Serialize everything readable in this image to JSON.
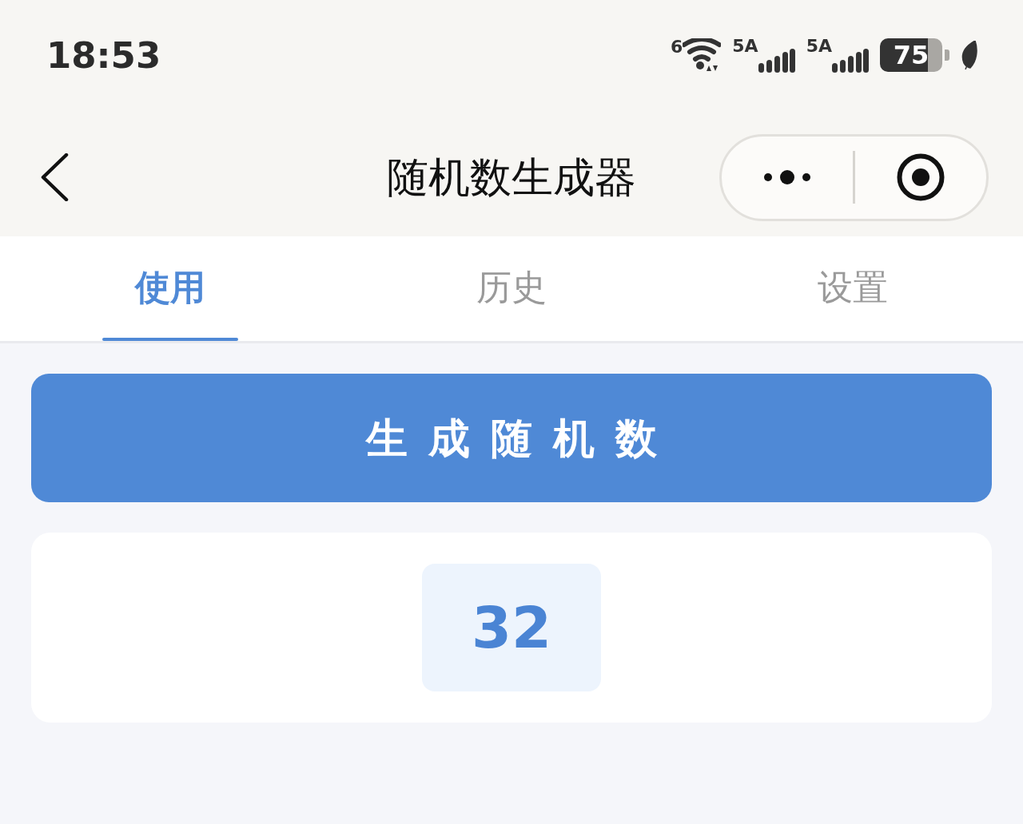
{
  "status_bar": {
    "time": "18:53",
    "wifi_label": "6",
    "signals": [
      "5A",
      "5A"
    ],
    "battery": "75"
  },
  "header": {
    "title": "随机数生成器"
  },
  "tabs": [
    {
      "label": "使用",
      "selected": true
    },
    {
      "label": "历史",
      "selected": false
    },
    {
      "label": "设置",
      "selected": false
    }
  ],
  "generate_button": {
    "label": "生成随机数"
  },
  "result": {
    "value": "32"
  }
}
